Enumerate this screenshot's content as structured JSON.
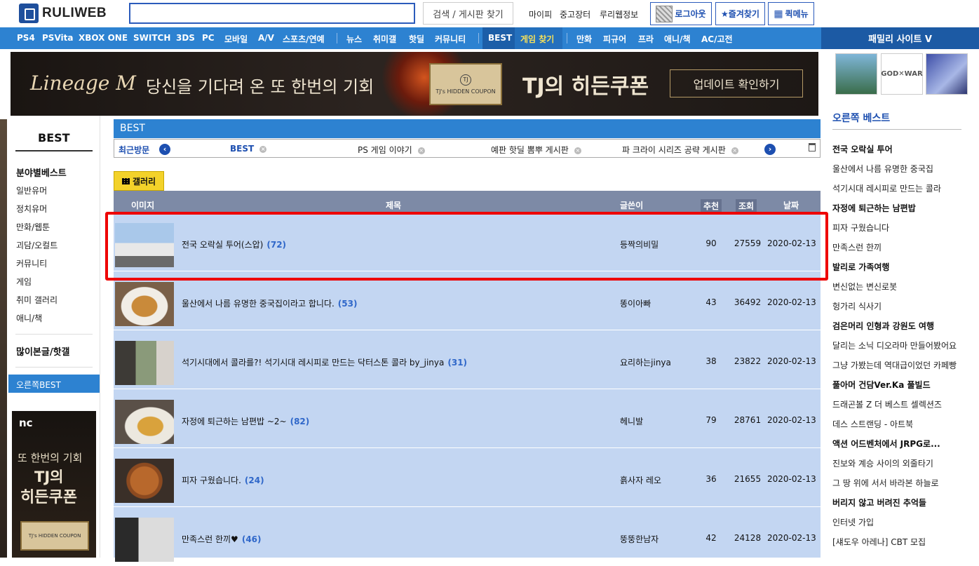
{
  "header": {
    "logo_text": "RULIWEB",
    "search_value": "",
    "search_button": "검색 / 게시판 찾기",
    "links": [
      "마이피",
      "중고장터",
      "루리웹정보"
    ],
    "logout": "로그아웃",
    "bookmark": "★즐겨찾기",
    "quickmenu": "퀵메뉴"
  },
  "nav": {
    "items": [
      "PS4",
      "PSVita",
      "XBOX ONE",
      "SWITCH",
      "3DS",
      "PC",
      "모바일",
      "A/V",
      "스포츠/연예",
      "뉴스",
      "취미갤",
      "핫딜",
      "커뮤니티",
      "BEST",
      "게임 찾기",
      "만화",
      "피규어",
      "프라",
      "애니/책",
      "AC/고전"
    ],
    "family": "패밀리 사이트 V"
  },
  "banner": {
    "logo": "Lineage M",
    "text1": "당신을 기다려 온 또 한번의 기회",
    "coupon": "TJ's HIDDEN COUPON",
    "text2": "TJ의 히든쿠폰",
    "update": "업데이트 확인하기"
  },
  "left": {
    "title": "BEST",
    "section1": "분야별베스트",
    "items": [
      "일반유머",
      "정치유머",
      "만화/웹툰",
      "괴담/오컬트",
      "커뮤니티",
      "게임",
      "취미 갤러리",
      "애니/책"
    ],
    "section2": "많이본글/핫갤",
    "selected": "오른쪽BEST"
  },
  "left_ad": {
    "brand": "nc",
    "line1": "또 한번의 기회",
    "line2": "TJ의",
    "line3": "히든쿠폰",
    "coupon": "TJ's HIDDEN COUPON"
  },
  "board": {
    "title": "BEST",
    "recent_label": "최근방문",
    "recent_tabs": [
      "BEST",
      "PS 게임 이야기",
      "예판 핫딜 뽐뿌 게시판",
      "파 크라이 시리즈 공략 게시판"
    ],
    "gallery_tab": "갤러리",
    "columns": {
      "image": "이미지",
      "title": "제목",
      "author": "글쓴이",
      "recommend": "추천",
      "views": "조회",
      "date": "날짜"
    },
    "rows": [
      {
        "title": "전국 오락실 투어(스압)",
        "comments": "(72)",
        "author": "등짝의비밀",
        "recommend": "90",
        "views": "27559",
        "date": "2020-02-13"
      },
      {
        "title": "울산에서 나름 유명한 중국집이라고 합니다.",
        "comments": "(53)",
        "author": "똥이아빠",
        "recommend": "43",
        "views": "36492",
        "date": "2020-02-13"
      },
      {
        "title": "석기시대에서 콜라를?! 석기시대 레시피로 만드는 닥터스톤 콜라 by_jinya",
        "comments": "(31)",
        "author": "요리하는jinya",
        "recommend": "38",
        "views": "23822",
        "date": "2020-02-13"
      },
      {
        "title": "자정에 퇴근하는 남편밥 ~2~",
        "comments": "(82)",
        "author": "헤니발",
        "recommend": "79",
        "views": "28761",
        "date": "2020-02-13"
      },
      {
        "title": "피자 구웠습니다.",
        "comments": "(24)",
        "author": "흙사자 레오",
        "recommend": "36",
        "views": "21655",
        "date": "2020-02-13"
      },
      {
        "title": "만족스런 한끼♥",
        "comments": "(46)",
        "author": "뚱뚱한남자",
        "recommend": "42",
        "views": "24128",
        "date": "2020-02-13"
      }
    ]
  },
  "right": {
    "title": "오른쪽 베스트",
    "items": [
      {
        "text": "전국 오락실 투어",
        "bold": true
      },
      {
        "text": "울산에서 나름 유명한 중국집",
        "bold": false
      },
      {
        "text": "석기시대 레시피로 만드는 콜라",
        "bold": false
      },
      {
        "text": "자정에 퇴근하는 남편밥",
        "bold": true
      },
      {
        "text": "피자 구웠습니다",
        "bold": false
      },
      {
        "text": "만족스런 한끼",
        "bold": false
      },
      {
        "text": "발리로 가족여행",
        "bold": true
      },
      {
        "text": "변신없는 변신로봇",
        "bold": false
      },
      {
        "text": "헝가리 식사기",
        "bold": false
      },
      {
        "text": "검은머리 인형과 강원도 여행",
        "bold": true
      },
      {
        "text": "달리는 소닉 디오라마 만들어봤어요",
        "bold": false
      },
      {
        "text": "그냥 가봤는데 역대급이었던 카페빵",
        "bold": false
      },
      {
        "text": "풀아머 건담Ver.Ka 풀빌드",
        "bold": true
      },
      {
        "text": "드래곤볼 Z 더 베스트 셀렉션즈",
        "bold": false
      },
      {
        "text": "데스 스트랜딩 - 아트북",
        "bold": false
      },
      {
        "text": "액션 어드벤처에서 JRPG로...",
        "bold": true
      },
      {
        "text": "진보와 계승 사이의 외줄타기",
        "bold": false
      },
      {
        "text": "그 땅 위에 서서 바라본 하늘로",
        "bold": false
      },
      {
        "text": "버리지 않고 버려진 추억들",
        "bold": true
      },
      {
        "text": "인터넷 가입",
        "bold": false
      },
      {
        "text": "[섀도우 아레나] CBT 모집",
        "bold": false
      }
    ]
  },
  "colors": {
    "nav_blue": "#2d82d1",
    "row_bg": "#c3d6f2",
    "header_gray": "#7d8aa6",
    "highlight": "#ee0000",
    "gallery_yellow": "#f3d22a"
  }
}
